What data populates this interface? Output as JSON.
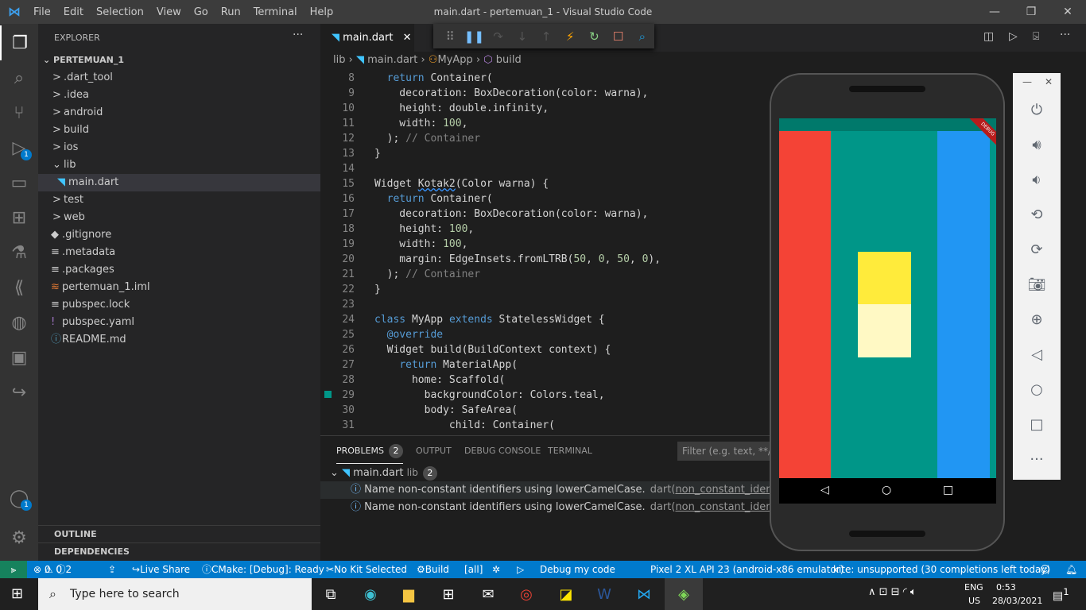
{
  "window": {
    "title": "main.dart - pertemuan_1 - Visual Studio Code",
    "menu": [
      "File",
      "Edit",
      "Selection",
      "View",
      "Go",
      "Run",
      "Terminal",
      "Help"
    ]
  },
  "activity": {
    "icons": [
      "explorer-icon",
      "search-icon",
      "source-control-icon",
      "run-debug-icon",
      "remote-explorer-icon",
      "extensions-icon",
      "testing-icon",
      "flutter-icon",
      "github-icon",
      "docker-icon",
      "live-share-icon",
      "accounts-icon",
      "settings-icon"
    ],
    "badges": {
      "run-debug": "1",
      "accounts": "1"
    }
  },
  "sidebar": {
    "header": "EXPLORER",
    "more": "···",
    "project": "PERTEMUAN_1",
    "items": [
      {
        "label": ".dart_tool",
        "kind": "folder",
        "icon": ">"
      },
      {
        "label": ".idea",
        "kind": "folder",
        "icon": ">"
      },
      {
        "label": "android",
        "kind": "folder",
        "icon": ">"
      },
      {
        "label": "build",
        "kind": "folder",
        "icon": ">"
      },
      {
        "label": "ios",
        "kind": "folder",
        "icon": ">"
      },
      {
        "label": "lib",
        "kind": "folder-open",
        "icon": "⌄"
      },
      {
        "label": "main.dart",
        "kind": "file",
        "icon": "◥"
      },
      {
        "label": "test",
        "kind": "folder",
        "icon": ">"
      },
      {
        "label": "web",
        "kind": "folder",
        "icon": ">"
      },
      {
        "label": ".gitignore",
        "kind": "file",
        "icon": "◆"
      },
      {
        "label": ".metadata",
        "kind": "file",
        "icon": "≡"
      },
      {
        "label": ".packages",
        "kind": "file",
        "icon": "≡"
      },
      {
        "label": "pertemuan_1.iml",
        "kind": "file",
        "icon": "≋"
      },
      {
        "label": "pubspec.lock",
        "kind": "file",
        "icon": "≡"
      },
      {
        "label": "pubspec.yaml",
        "kind": "file",
        "icon": "!"
      },
      {
        "label": "README.md",
        "kind": "file",
        "icon": "ⓘ"
      }
    ],
    "outline": "OUTLINE",
    "dependencies": "DEPENDENCIES"
  },
  "editor": {
    "tab": "main.dart",
    "close": "✕",
    "breadcrumb": [
      "lib",
      "main.dart",
      "MyApp",
      "build"
    ],
    "lines": [
      {
        "n": "8",
        "t": [
          [
            "  ",
            ""
          ],
          [
            "return",
            "kw"
          ],
          [
            " Container(",
            "id"
          ]
        ]
      },
      {
        "n": "9",
        "t": [
          [
            "    decoration: BoxDecoration(color: warna),",
            "id"
          ]
        ]
      },
      {
        "n": "10",
        "t": [
          [
            "    height: double.infinity,",
            "id"
          ]
        ]
      },
      {
        "n": "11",
        "t": [
          [
            "    width: ",
            "id"
          ],
          [
            "100",
            "num"
          ],
          [
            ",",
            "id"
          ]
        ]
      },
      {
        "n": "12",
        "t": [
          [
            "  ); ",
            "id"
          ],
          [
            "// Container",
            "cm"
          ]
        ]
      },
      {
        "n": "13",
        "t": [
          [
            "}",
            "id"
          ]
        ]
      },
      {
        "n": "14",
        "t": []
      },
      {
        "n": "15",
        "t": [
          [
            "Widget ",
            "id"
          ],
          [
            "Kotak2",
            "id sq"
          ],
          [
            "(Color warna) {",
            "id"
          ]
        ]
      },
      {
        "n": "16",
        "t": [
          [
            "  ",
            ""
          ],
          [
            "return",
            "kw"
          ],
          [
            " Container(",
            "id"
          ]
        ]
      },
      {
        "n": "17",
        "t": [
          [
            "    decoration: BoxDecoration(color: warna),",
            "id"
          ]
        ]
      },
      {
        "n": "18",
        "t": [
          [
            "    height: ",
            "id"
          ],
          [
            "100",
            "num"
          ],
          [
            ",",
            "id"
          ]
        ]
      },
      {
        "n": "19",
        "t": [
          [
            "    width: ",
            "id"
          ],
          [
            "100",
            "num"
          ],
          [
            ",",
            "id"
          ]
        ]
      },
      {
        "n": "20",
        "t": [
          [
            "    margin: EdgeInsets.fromLTRB(",
            "id"
          ],
          [
            "50",
            "num"
          ],
          [
            ", ",
            "id"
          ],
          [
            "0",
            "num"
          ],
          [
            ", ",
            "id"
          ],
          [
            "50",
            "num"
          ],
          [
            ", ",
            "id"
          ],
          [
            "0",
            "num"
          ],
          [
            "),",
            "id"
          ]
        ]
      },
      {
        "n": "21",
        "t": [
          [
            "  ); ",
            "id"
          ],
          [
            "// Container",
            "cm"
          ]
        ]
      },
      {
        "n": "22",
        "t": [
          [
            "}",
            "id"
          ]
        ]
      },
      {
        "n": "23",
        "t": []
      },
      {
        "n": "24",
        "t": [
          [
            "class",
            "kw"
          ],
          [
            " MyApp ",
            "id"
          ],
          [
            "extends",
            "kw"
          ],
          [
            " StatelessWidget {",
            "id"
          ]
        ]
      },
      {
        "n": "25",
        "t": [
          [
            "  ",
            ""
          ],
          [
            "@override",
            "an"
          ]
        ]
      },
      {
        "n": "26",
        "t": [
          [
            "  Widget build(BuildContext context) {",
            "id"
          ]
        ]
      },
      {
        "n": "27",
        "t": [
          [
            "    ",
            ""
          ],
          [
            "return",
            "kw"
          ],
          [
            " MaterialApp(",
            "id"
          ]
        ]
      },
      {
        "n": "28",
        "t": [
          [
            "      home: Scaffold(",
            "id"
          ]
        ]
      },
      {
        "n": "29",
        "t": [
          [
            "        backgroundColor: Colors.teal,",
            "id"
          ]
        ]
      },
      {
        "n": "30",
        "t": [
          [
            "        body: SafeArea(",
            "id"
          ]
        ]
      },
      {
        "n": "31",
        "t": [
          [
            "            child: Container(",
            "id"
          ]
        ]
      }
    ]
  },
  "debug_toolbar": [
    "drag-handle-icon",
    "pause-icon",
    "step-over-icon",
    "step-into-icon",
    "step-out-icon",
    "hot-reload-icon",
    "hot-restart-icon",
    "stop-icon",
    "devtools-icon"
  ],
  "panel": {
    "tabs": [
      "PROBLEMS",
      "OUTPUT",
      "DEBUG CONSOLE",
      "TERMINAL"
    ],
    "problems_count": "2",
    "filter_placeholder": "Filter (e.g. text, **/*.ts",
    "file": "main.dart",
    "folder": "lib",
    "file_count": "2",
    "problems": [
      {
        "msg": "Name non-constant identifiers using lowerCamelCase.",
        "src": "dart(",
        "code": "non_constant_identifier_nam"
      },
      {
        "msg": "Name non-constant identifiers using lowerCamelCase.",
        "src": "dart(",
        "code": "non_constant_identifier_nam"
      }
    ]
  },
  "status": {
    "remote": "⫸",
    "errors": "0",
    "warnings": "0",
    "infos": "2",
    "live_share": "Live Share",
    "cmake": "CMake: [Debug]: Ready",
    "kit": "No Kit Selected",
    "build": "Build",
    "target": "[all]",
    "debug": "Debug my code",
    "device": "Pixel 2 XL API 23 (android-x86 emulator)",
    "kite": "kite: unsupported (30 completions left today)"
  },
  "taskbar": {
    "search_placeholder": "Type here to search",
    "lang": "ENG",
    "region": "US",
    "time": "0:53",
    "date": "28/03/2021",
    "notifications": "1"
  },
  "emulator": {
    "colors": {
      "red": "#f44336",
      "teal": "#009688",
      "blue": "#2196f3",
      "yellow": "#ffeb3b",
      "lightyellow": "#fff9c4"
    },
    "banner": "DEBUG",
    "tools": [
      "power-icon",
      "volume-up-icon",
      "volume-down-icon",
      "rotate-left-icon",
      "rotate-right-icon",
      "camera-icon",
      "zoom-icon",
      "back-icon",
      "home-icon",
      "overview-icon",
      "more-icon"
    ]
  }
}
